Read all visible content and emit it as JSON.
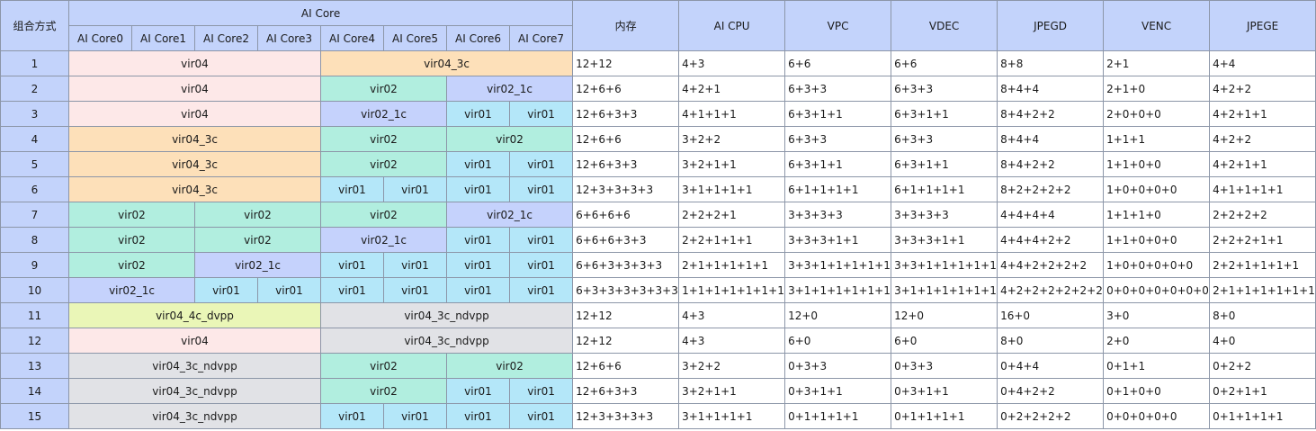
{
  "header": {
    "mode": "组合方式",
    "ai_core": "AI Core",
    "cores": [
      "AI Core0",
      "AI Core1",
      "AI Core2",
      "AI Core3",
      "AI Core4",
      "AI Core5",
      "AI Core6",
      "AI Core7"
    ],
    "resources": [
      "内存",
      "AI CPU",
      "VPC",
      "VDEC",
      "JPEGD",
      "VENC",
      "JPEGE"
    ]
  },
  "colors": {
    "header_bg": "#c3d3fb",
    "vir04": "#fde8e8",
    "vir04_3c": "#fde0b9",
    "vir02": "#b1eedf",
    "vir02_1c": "#c5d2fc",
    "vir01": "#b4e7f9",
    "vir04_4c_dvpp": "#eaf6b7",
    "vir04_3c_ndvpp": "#e1e2e6"
  },
  "rows": [
    {
      "id": "1",
      "cores": [
        {
          "name": "vir04",
          "span": 4
        },
        {
          "name": "vir04_3c",
          "span": 4
        }
      ],
      "res": [
        "12+12",
        "4+3",
        "6+6",
        "6+6",
        "8+8",
        "2+1",
        "4+4"
      ]
    },
    {
      "id": "2",
      "cores": [
        {
          "name": "vir04",
          "span": 4
        },
        {
          "name": "vir02",
          "span": 2
        },
        {
          "name": "vir02_1c",
          "span": 2
        }
      ],
      "res": [
        "12+6+6",
        "4+2+1",
        "6+3+3",
        "6+3+3",
        "8+4+4",
        "2+1+0",
        "4+2+2"
      ]
    },
    {
      "id": "3",
      "cores": [
        {
          "name": "vir04",
          "span": 4
        },
        {
          "name": "vir02_1c",
          "span": 2
        },
        {
          "name": "vir01",
          "span": 1
        },
        {
          "name": "vir01",
          "span": 1
        }
      ],
      "res": [
        "12+6+3+3",
        "4+1+1+1",
        "6+3+1+1",
        "6+3+1+1",
        "8+4+2+2",
        "2+0+0+0",
        "4+2+1+1"
      ]
    },
    {
      "id": "4",
      "cores": [
        {
          "name": "vir04_3c",
          "span": 4
        },
        {
          "name": "vir02",
          "span": 2
        },
        {
          "name": "vir02",
          "span": 2
        }
      ],
      "res": [
        "12+6+6",
        "3+2+2",
        "6+3+3",
        "6+3+3",
        "8+4+4",
        "1+1+1",
        "4+2+2"
      ]
    },
    {
      "id": "5",
      "cores": [
        {
          "name": "vir04_3c",
          "span": 4
        },
        {
          "name": "vir02",
          "span": 2
        },
        {
          "name": "vir01",
          "span": 1
        },
        {
          "name": "vir01",
          "span": 1
        }
      ],
      "res": [
        "12+6+3+3",
        "3+2+1+1",
        "6+3+1+1",
        "6+3+1+1",
        "8+4+2+2",
        "1+1+0+0",
        "4+2+1+1"
      ]
    },
    {
      "id": "6",
      "cores": [
        {
          "name": "vir04_3c",
          "span": 4
        },
        {
          "name": "vir01",
          "span": 1
        },
        {
          "name": "vir01",
          "span": 1
        },
        {
          "name": "vir01",
          "span": 1
        },
        {
          "name": "vir01",
          "span": 1
        }
      ],
      "res": [
        "12+3+3+3+3",
        "3+1+1+1+1",
        "6+1+1+1+1",
        "6+1+1+1+1",
        "8+2+2+2+2",
        "1+0+0+0+0",
        "4+1+1+1+1"
      ]
    },
    {
      "id": "7",
      "cores": [
        {
          "name": "vir02",
          "span": 2
        },
        {
          "name": "vir02",
          "span": 2
        },
        {
          "name": "vir02",
          "span": 2
        },
        {
          "name": "vir02_1c",
          "span": 2
        }
      ],
      "res": [
        "6+6+6+6",
        "2+2+2+1",
        "3+3+3+3",
        "3+3+3+3",
        "4+4+4+4",
        "1+1+1+0",
        "2+2+2+2"
      ]
    },
    {
      "id": "8",
      "cores": [
        {
          "name": "vir02",
          "span": 2
        },
        {
          "name": "vir02",
          "span": 2
        },
        {
          "name": "vir02_1c",
          "span": 2
        },
        {
          "name": "vir01",
          "span": 1
        },
        {
          "name": "vir01",
          "span": 1
        }
      ],
      "res": [
        "6+6+6+3+3",
        "2+2+1+1+1",
        "3+3+3+1+1",
        "3+3+3+1+1",
        "4+4+4+2+2",
        "1+1+0+0+0",
        "2+2+2+1+1"
      ]
    },
    {
      "id": "9",
      "cores": [
        {
          "name": "vir02",
          "span": 2
        },
        {
          "name": "vir02_1c",
          "span": 2
        },
        {
          "name": "vir01",
          "span": 1
        },
        {
          "name": "vir01",
          "span": 1
        },
        {
          "name": "vir01",
          "span": 1
        },
        {
          "name": "vir01",
          "span": 1
        }
      ],
      "res": [
        "6+6+3+3+3+3",
        "2+1+1+1+1+1",
        "3+3+1+1+1+1+1",
        "3+3+1+1+1+1+1",
        "4+4+2+2+2+2",
        "1+0+0+0+0+0",
        "2+2+1+1+1+1"
      ]
    },
    {
      "id": "10",
      "cores": [
        {
          "name": "vir02_1c",
          "span": 2
        },
        {
          "name": "vir01",
          "span": 1
        },
        {
          "name": "vir01",
          "span": 1
        },
        {
          "name": "vir01",
          "span": 1
        },
        {
          "name": "vir01",
          "span": 1
        },
        {
          "name": "vir01",
          "span": 1
        },
        {
          "name": "vir01",
          "span": 1
        }
      ],
      "res": [
        "6+3+3+3+3+3+3",
        "1+1+1+1+1+1+1",
        "3+1+1+1+1+1+1",
        "3+1+1+1+1+1+1",
        "4+2+2+2+2+2+2",
        "0+0+0+0+0+0+0",
        "2+1+1+1+1+1+1"
      ]
    },
    {
      "id": "11",
      "cores": [
        {
          "name": "vir04_4c_dvpp",
          "span": 4
        },
        {
          "name": "vir04_3c_ndvpp",
          "span": 4
        }
      ],
      "res": [
        "12+12",
        "4+3",
        "12+0",
        "12+0",
        "16+0",
        "3+0",
        "8+0"
      ]
    },
    {
      "id": "12",
      "cores": [
        {
          "name": "vir04",
          "span": 4
        },
        {
          "name": "vir04_3c_ndvpp",
          "span": 4
        }
      ],
      "res": [
        "12+12",
        "4+3",
        "6+0",
        "6+0",
        "8+0",
        "2+0",
        "4+0"
      ]
    },
    {
      "id": "13",
      "cores": [
        {
          "name": "vir04_3c_ndvpp",
          "span": 4
        },
        {
          "name": "vir02",
          "span": 2
        },
        {
          "name": "vir02",
          "span": 2
        }
      ],
      "res": [
        "12+6+6",
        "3+2+2",
        "0+3+3",
        "0+3+3",
        "0+4+4",
        "0+1+1",
        "0+2+2"
      ]
    },
    {
      "id": "14",
      "cores": [
        {
          "name": "vir04_3c_ndvpp",
          "span": 4
        },
        {
          "name": "vir02",
          "span": 2
        },
        {
          "name": "vir01",
          "span": 1
        },
        {
          "name": "vir01",
          "span": 1
        }
      ],
      "res": [
        "12+6+3+3",
        "3+2+1+1",
        "0+3+1+1",
        "0+3+1+1",
        "0+4+2+2",
        "0+1+0+0",
        "0+2+1+1"
      ]
    },
    {
      "id": "15",
      "cores": [
        {
          "name": "vir04_3c_ndvpp",
          "span": 4
        },
        {
          "name": "vir01",
          "span": 1
        },
        {
          "name": "vir01",
          "span": 1
        },
        {
          "name": "vir01",
          "span": 1
        },
        {
          "name": "vir01",
          "span": 1
        }
      ],
      "res": [
        "12+3+3+3+3",
        "3+1+1+1+1",
        "0+1+1+1+1",
        "0+1+1+1+1",
        "0+2+2+2+2",
        "0+0+0+0+0",
        "0+1+1+1+1"
      ]
    }
  ]
}
